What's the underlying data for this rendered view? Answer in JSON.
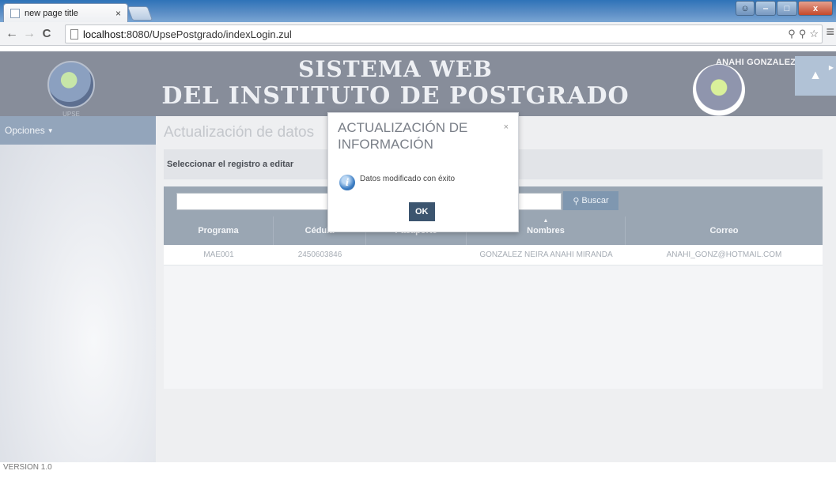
{
  "browser": {
    "tab_title": "new page title",
    "tab_close": "×",
    "url_host": "localhost",
    "url_rest": ":8080/UpsePostgrado/indexLogin.zul",
    "win_min": "‒",
    "win_max": "□",
    "win_close": "x"
  },
  "header": {
    "title_line1": "SISTEMA WEB",
    "title_line2": "DEL INSTITUTO DE POSTGRADO",
    "left_logo_text": "UPSE",
    "user_name": "ANAHI GONZALEZ"
  },
  "sidebar": {
    "menu_label": "Opciones"
  },
  "content": {
    "page_title": "Actualización de datos",
    "panel_title": "Seleccionar el registro a editar",
    "search_button": "Buscar",
    "search_value": "",
    "columns": [
      "Programa",
      "Cédula",
      "Pasaporte",
      "Nombres",
      "Correo"
    ],
    "rows": [
      {
        "programa": "MAE001",
        "cedula": "2450603846",
        "pasaporte": "",
        "nombres": "GONZALEZ NEIRA ANAHI MIRANDA",
        "correo": "ANAHI_GONZ@HOTMAIL.COM"
      }
    ]
  },
  "footer": {
    "version": "VERSION 1.0"
  },
  "modal": {
    "title": "ACTUALIZACIÓN DE INFORMACIÓN",
    "close": "×",
    "message": "Datos modificado con éxito",
    "ok_label": "OK"
  }
}
